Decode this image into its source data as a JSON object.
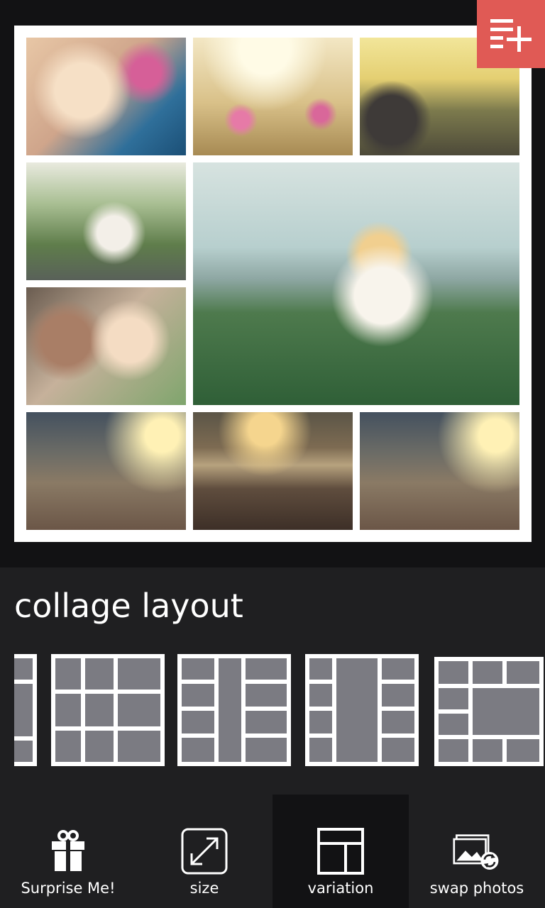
{
  "section_title": "collage layout",
  "appbar": {
    "surprise_label": "Surprise Me!",
    "size_label": "size",
    "variation_label": "variation",
    "swap_label": "swap photos",
    "selected": "variation"
  },
  "colors": {
    "accent": "#e05a55",
    "background": "#121214",
    "panel": "#1f1f21",
    "selected_tab": "#121214",
    "thumb_cell": "#7b7b82"
  },
  "icons": {
    "add": "add-to-playlist-icon",
    "surprise": "gift-icon",
    "size": "resize-arrows-icon",
    "variation": "layout-icon",
    "swap": "swap-photos-icon"
  }
}
